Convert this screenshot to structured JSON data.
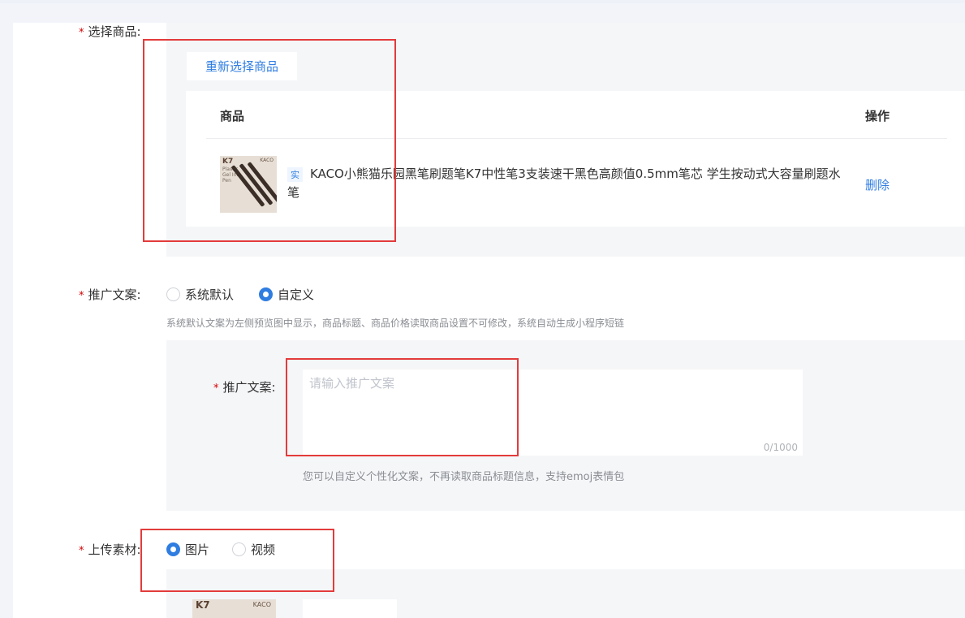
{
  "form": {
    "select_product": {
      "label": "选择商品:",
      "reselect_button": "重新选择商品",
      "table": {
        "col_product": "商品",
        "col_action": "操作",
        "rows": [
          {
            "tag": "实",
            "title": "KACO小熊猫乐园黑笔刷题笔K7中性笔3支装速干黑色高颜值0.5mm笔芯 学生按动式大容量刷题水笔",
            "action": "删除",
            "thumb_text": {
              "model": "K7",
              "brand": "KACO",
              "sub": "Plastic Gel Ink Pen"
            }
          }
        ]
      }
    },
    "promo_copy": {
      "label": "推广文案:",
      "options": [
        {
          "label": "系统默认",
          "checked": false
        },
        {
          "label": "自定义",
          "checked": true
        }
      ],
      "hint": "系统默认文案为左侧预览图中显示，商品标题、商品价格读取商品设置不可修改，系统自动生成小程序短链",
      "inner_label": "推广文案:",
      "placeholder": "请输入推广文案",
      "counter": "0/1000",
      "inner_hint": "您可以自定义个性化文案，不再读取商品标题信息，支持emoj表情包"
    },
    "upload_material": {
      "label": "上传素材:",
      "options": [
        {
          "label": "图片",
          "checked": true
        },
        {
          "label": "视频",
          "checked": false
        }
      ],
      "thumb_text": {
        "model": "K7",
        "brand": "KACO"
      }
    },
    "required_mark": "*"
  },
  "colors": {
    "accent": "#2f7de1",
    "required": "#d40000",
    "annotation": "#e33b3b",
    "panel_bg": "#f5f6f8"
  }
}
